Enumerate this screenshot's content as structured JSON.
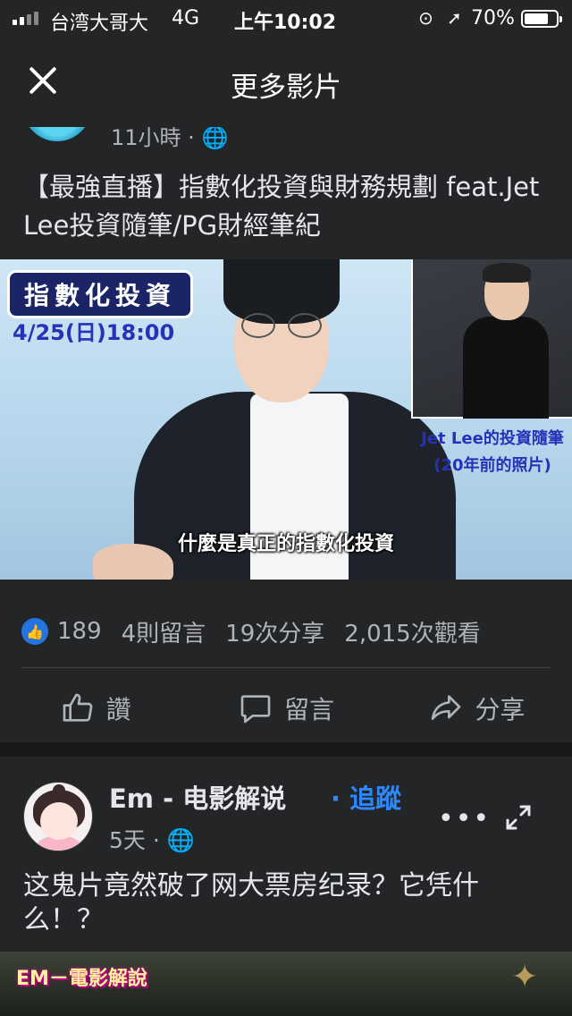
{
  "status_bar": {
    "carrier": "台湾大哥大",
    "network": "4G",
    "time": "上午10:02",
    "battery": "70%",
    "icons": [
      "signal-icon",
      "orientation-lock-icon",
      "location-icon",
      "battery-icon"
    ]
  },
  "header": {
    "title": "更多影片",
    "close_icon": "close-icon"
  },
  "post1": {
    "time": "11小時",
    "text": "【最強直播】指數化投資與財務規劃 feat.Jet Lee投資隨筆/PG財經筆紀",
    "video": {
      "badge": "指數化投資",
      "date": "4/25(日)18:00",
      "inset_caption": "Jet Lee的投資隨筆",
      "inset_note": "(20年前的照片)",
      "subtitle": "什麼是真正的指數化投資"
    },
    "stats": {
      "likes": "189",
      "comments": "4則留言",
      "shares": "19次分享",
      "views": "2,015次觀看"
    },
    "actions": {
      "like": "讚",
      "comment": "留言",
      "share": "分享"
    }
  },
  "post2": {
    "page_name": "Em - 电影解说",
    "follow": "· 追蹤",
    "time": "5天 · ",
    "text": "这鬼片竟然破了网大票房纪录？它凭什么！？",
    "video_label": "EM－電影解說",
    "more": "•••"
  },
  "colors": {
    "background": "#18191a",
    "card": "#242526",
    "accent": "#2d88ff",
    "like_badge": "#2374e1"
  }
}
